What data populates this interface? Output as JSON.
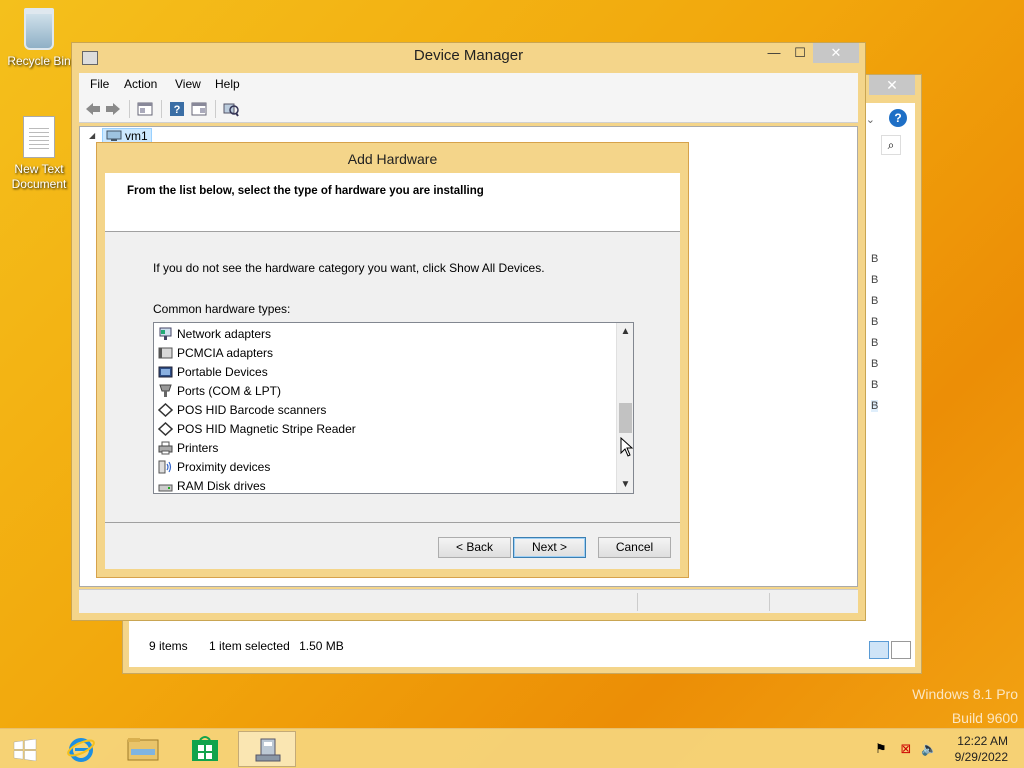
{
  "desktop": {
    "icons": [
      {
        "label": "Recycle Bin"
      },
      {
        "label": "New Text Document"
      }
    ],
    "watermark": {
      "line1": "Windows 8.1 Pro",
      "line2": "Build 9600"
    }
  },
  "explorer": {
    "close_glyph": "✕",
    "status_items": "9 items",
    "status_selected": "1 item selected",
    "status_size": "1.50 MB",
    "size_col_fragment": "B",
    "help_glyph": "?",
    "search_glyph": "⌕"
  },
  "device_manager": {
    "title": "Device Manager",
    "caption": {
      "minimize": "—",
      "maximize": "☐",
      "close": "✕"
    },
    "menu": [
      "File",
      "Action",
      "View",
      "Help"
    ],
    "toolbar_icons": [
      "back-arrow-icon",
      "forward-arrow-icon",
      "properties-icon",
      "help-icon",
      "show-hide-icon",
      "scan-hardware-icon"
    ],
    "tree_root": "vm1",
    "tree_expander": "◢"
  },
  "add_hardware": {
    "title": "Add Hardware",
    "header": "From the list below, select the type of hardware you are installing",
    "hint": "If you do not see the hardware category you want, click Show All Devices.",
    "list_label": "Common hardware types:",
    "items": [
      {
        "label": "Network adapters",
        "icon": "network-adapter-icon"
      },
      {
        "label": "PCMCIA adapters",
        "icon": "pcmcia-adapter-icon"
      },
      {
        "label": "Portable Devices",
        "icon": "portable-device-icon"
      },
      {
        "label": "Ports (COM & LPT)",
        "icon": "port-icon"
      },
      {
        "label": "POS HID Barcode scanners",
        "icon": "pos-hid-icon"
      },
      {
        "label": "POS HID Magnetic Stripe Reader",
        "icon": "pos-hid-icon"
      },
      {
        "label": "Printers",
        "icon": "printer-icon"
      },
      {
        "label": "Proximity devices",
        "icon": "proximity-device-icon"
      },
      {
        "label": "RAM Disk drives",
        "icon": "disk-drive-icon"
      }
    ],
    "scroll_up": "▲",
    "scroll_down": "▼",
    "buttons": {
      "back": "< Back",
      "next": "Next >",
      "cancel": "Cancel"
    }
  },
  "taskbar": {
    "time": "12:22 AM",
    "date": "9/29/2022",
    "apps": [
      "start-icon",
      "internet-explorer-icon",
      "file-explorer-icon",
      "store-icon",
      "device-manager-icon"
    ]
  }
}
